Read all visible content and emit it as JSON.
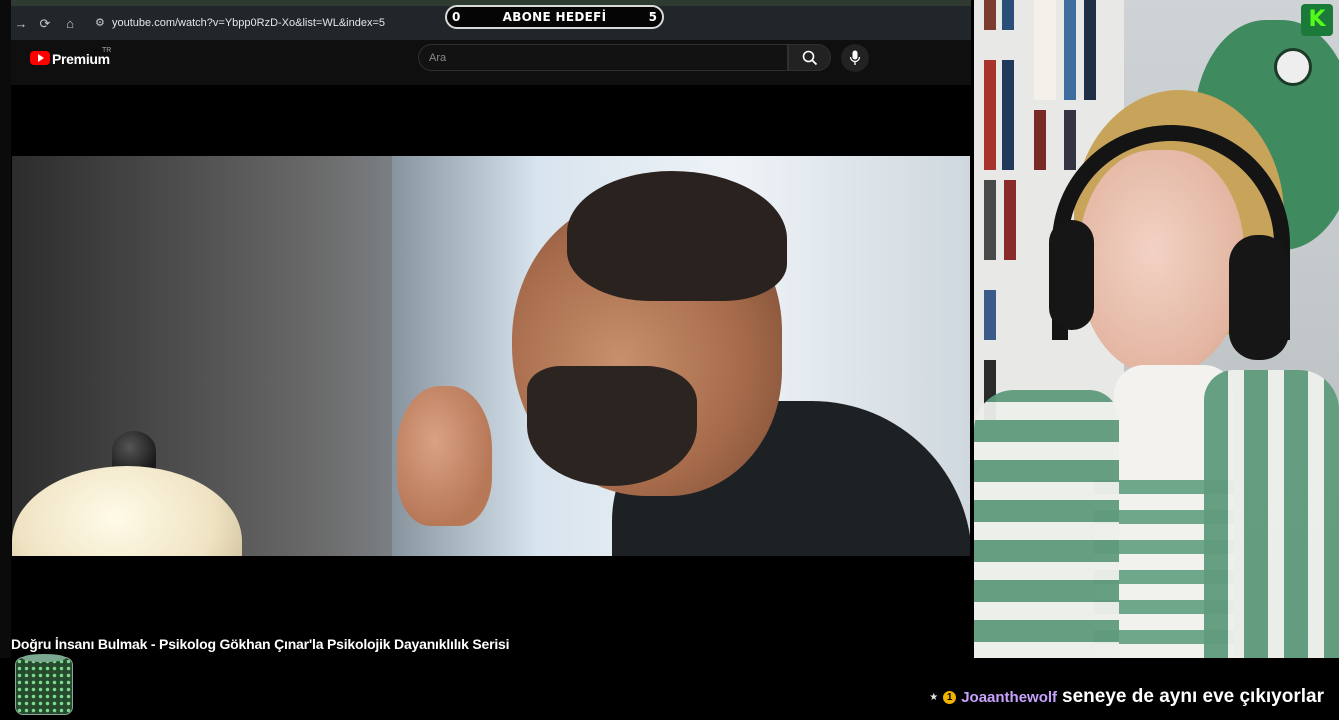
{
  "browser": {
    "url": "youtube.com/watch?v=Ybpp0RzD-Xo&list=WL&index=5",
    "icons": [
      "forward-icon",
      "reload-icon",
      "home-icon",
      "site-info-icon"
    ]
  },
  "goal": {
    "start": "0",
    "label": "ABONE HEDEFİ",
    "end": "5"
  },
  "youtube": {
    "logo_text": "Premium",
    "region": "TR",
    "search_placeholder": "Ara",
    "video_title": "Doğru İnsanı Bulmak - Psikolog Gökhan Çınar'la Psikolojik Dayanıklılık Serisi"
  },
  "platform_badge": "K",
  "chat": {
    "badge_number": "1",
    "username": "Joaanthewolf",
    "message": "seneye de aynı eve çıkıyorlar"
  },
  "colors": {
    "youtube_red": "#ff0000",
    "kick_green": "#53fc18",
    "chat_username": "#c7a3ff"
  }
}
